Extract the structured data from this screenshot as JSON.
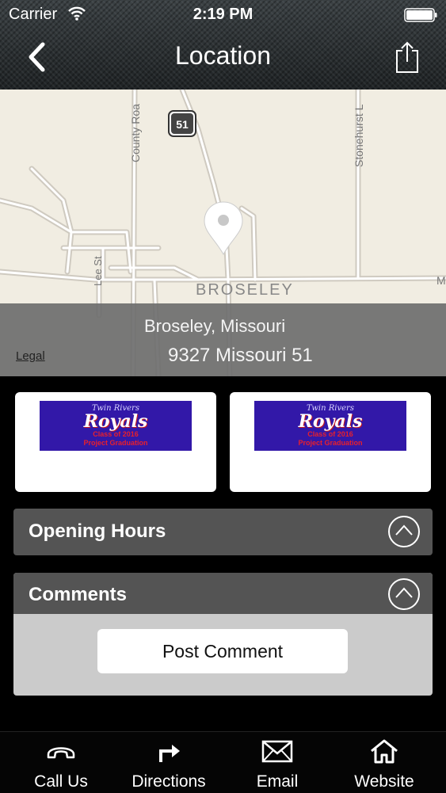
{
  "status_bar": {
    "carrier": "Carrier",
    "time": "2:19 PM"
  },
  "header": {
    "title": "Location",
    "back_icon": "chevron-left-icon",
    "share_icon": "share-icon"
  },
  "map": {
    "labels": {
      "highway": "51",
      "county_road": "County Roa",
      "stonehurst": "Stonehurst L",
      "lee_st": "Lee St",
      "town": "BROSELEY",
      "edge": "M"
    },
    "place_name": "Broseley, Missouri",
    "address": "9327 Missouri 51",
    "legal": "Legal"
  },
  "cards": [
    {
      "banner_top": "Twin Rivers",
      "banner_main": "Royals",
      "banner_sub1": "Class of 2016",
      "banner_sub2": "Project Graduation"
    },
    {
      "banner_top": "Twin Rivers",
      "banner_main": "Royals",
      "banner_sub1": "Class of 2016",
      "banner_sub2": "Project Graduation"
    }
  ],
  "sections": {
    "opening_hours": {
      "title": "Opening Hours"
    },
    "comments": {
      "title": "Comments",
      "post_button": "Post Comment"
    }
  },
  "tabs": [
    {
      "label": "Call Us",
      "icon": "phone-icon"
    },
    {
      "label": "Directions",
      "icon": "turn-right-arrow-icon"
    },
    {
      "label": "Email",
      "icon": "envelope-icon"
    },
    {
      "label": "Website",
      "icon": "home-icon"
    }
  ]
}
